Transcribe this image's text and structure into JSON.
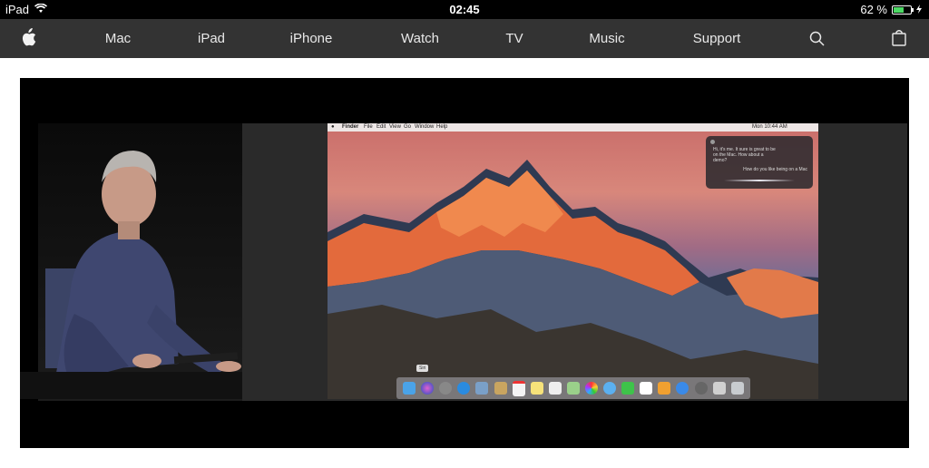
{
  "status_bar": {
    "device": "iPad",
    "time": "02:45",
    "battery_percent": "62 %",
    "battery_level": 0.62,
    "icons": [
      "wifi-icon",
      "battery-icon",
      "charging-bolt-icon"
    ]
  },
  "nav": {
    "logo": "apple-logo-icon",
    "items": [
      {
        "label": "Mac"
      },
      {
        "label": "iPad"
      },
      {
        "label": "iPhone"
      },
      {
        "label": "Watch"
      },
      {
        "label": "TV"
      },
      {
        "label": "Music"
      },
      {
        "label": "Support"
      }
    ],
    "search_icon": "search-icon",
    "bag_icon": "shopping-bag-icon",
    "colors": {
      "background": "#333333",
      "text": "#e8e8e8"
    }
  },
  "video": {
    "screen_menubar": {
      "items": [
        "Finder",
        "File",
        "Edit",
        "View",
        "Go",
        "Window",
        "Help"
      ],
      "clock": "Mon 10:44 AM"
    },
    "siri_panel": {
      "message": "Hi, it's me. It sure is great to be on the Mac. How about a demo?",
      "user_query": "How do you like being on a Mac"
    },
    "dock_badge": "Siri"
  }
}
